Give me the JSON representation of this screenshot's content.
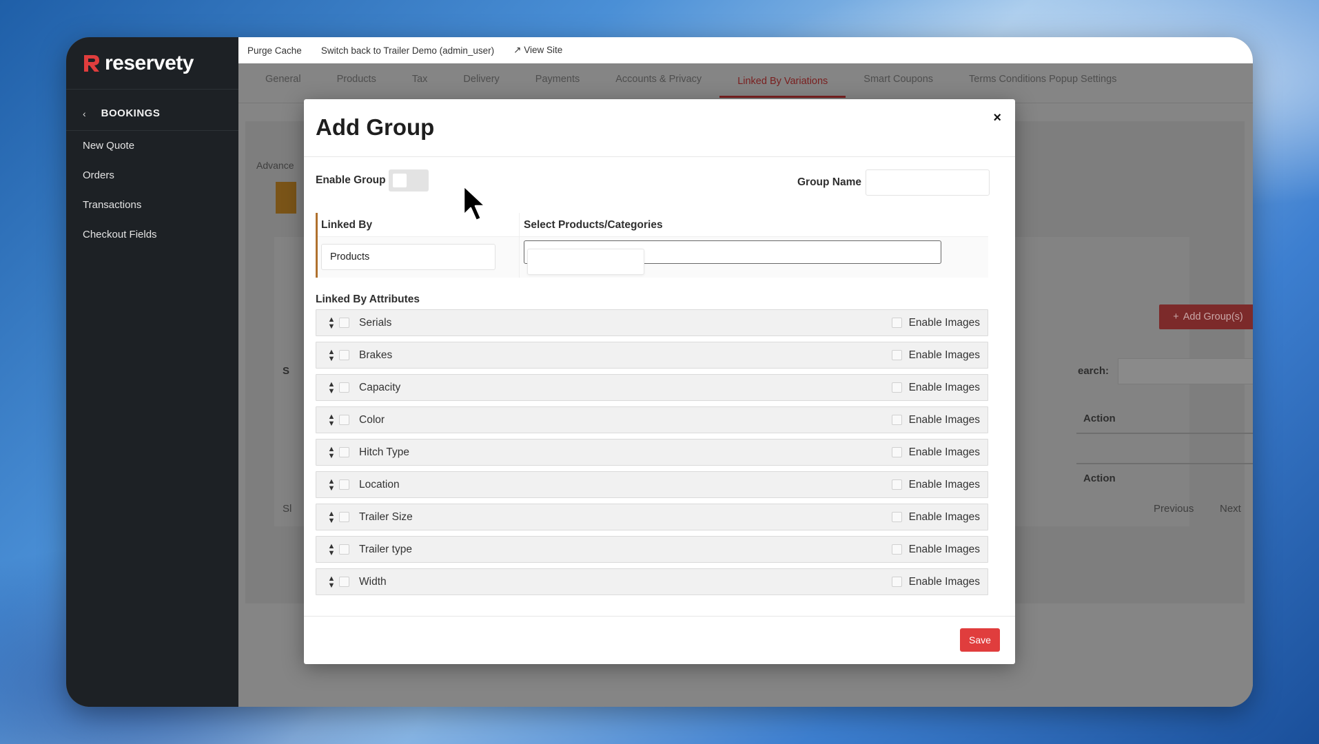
{
  "app": {
    "brand": "reservety",
    "colors": {
      "accent": "#e03d3d",
      "sidebar_bg": "#1d2125",
      "active_tab": "#7a2020"
    }
  },
  "sidebar": {
    "section": "BOOKINGS",
    "items": [
      {
        "label": "New Quote"
      },
      {
        "label": "Orders"
      },
      {
        "label": "Transactions"
      },
      {
        "label": "Checkout Fields"
      }
    ]
  },
  "topbar": {
    "purge": "Purge Cache",
    "switch_back": "Switch back to Trailer Demo (admin_user)",
    "view_site": "↗ View Site"
  },
  "tabs": [
    {
      "label": "General"
    },
    {
      "label": "Products"
    },
    {
      "label": "Tax"
    },
    {
      "label": "Delivery"
    },
    {
      "label": "Payments"
    },
    {
      "label": "Accounts & Privacy"
    },
    {
      "label": "Linked By Variations",
      "active": true
    },
    {
      "label": "Smart Coupons"
    },
    {
      "label": "Terms Conditions Popup Settings"
    }
  ],
  "background": {
    "subtab": "Advance",
    "add_group_button": "Add Group(s)",
    "search_label": "earch:",
    "action_header": "Action",
    "action_footer": "Action",
    "previous": "Previous",
    "next": "Next",
    "partial_s1": "S",
    "partial_s2": "Sl"
  },
  "modal": {
    "title": "Add Group",
    "close": "×",
    "enable_group_label": "Enable Group",
    "enable_group_on": false,
    "group_name_label": "Group Name",
    "group_name_value": "",
    "linked_by_header": "Linked By",
    "select_header": "Select Products/Categories",
    "linked_by_value": "Products",
    "attributes_label": "Linked By Attributes",
    "enable_images_label": "Enable Images",
    "attributes": [
      {
        "name": "Serials"
      },
      {
        "name": "Brakes"
      },
      {
        "name": "Capacity"
      },
      {
        "name": "Color"
      },
      {
        "name": "Hitch Type"
      },
      {
        "name": "Location"
      },
      {
        "name": "Trailer Size"
      },
      {
        "name": "Trailer type"
      },
      {
        "name": "Width"
      }
    ],
    "save_label": "Save"
  }
}
